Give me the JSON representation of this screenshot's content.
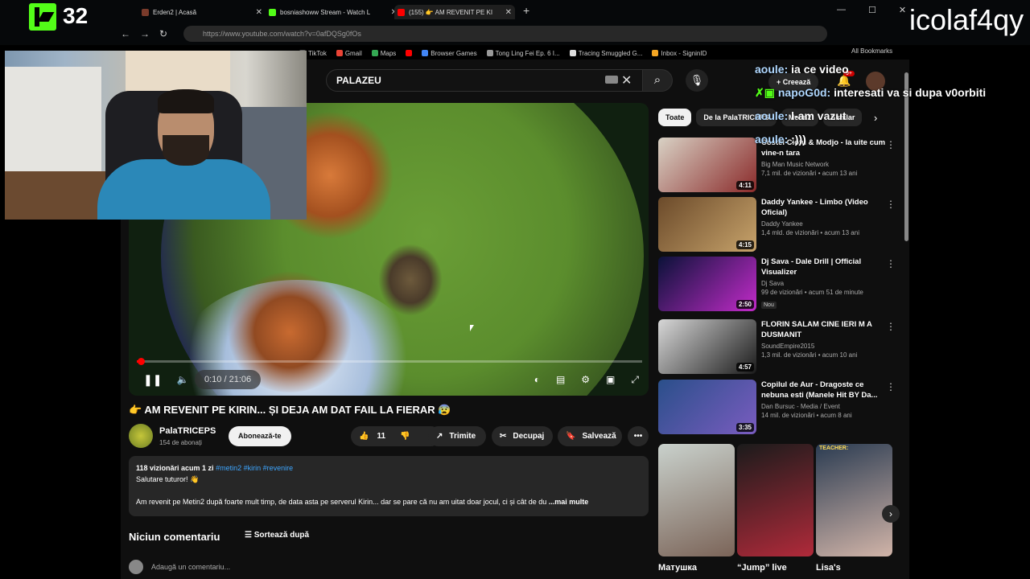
{
  "overlay": {
    "viewer_count": "32",
    "chat_handle": "icolaf4qy",
    "chat": [
      {
        "user": "aoule:",
        "text": "ia ce video"
      },
      {
        "user": "napoG0d:",
        "text": "interesati va si dupa v0orbiti"
      },
      {
        "user": "aoule:",
        "text": "l-am vazut"
      },
      {
        "user": "aoule:",
        "text": ":)))"
      }
    ]
  },
  "browser": {
    "tabs": [
      {
        "label": "Erden2 | Acasă",
        "color": "#7a3b2b"
      },
      {
        "label": "bosniashoww Stream - Watch L",
        "color": "#53fc18"
      },
      {
        "label": "(155) 👉 AM REVENIT PE KI",
        "color": "#ff0000"
      }
    ],
    "url": "https://www.youtube.com/watch?v=0afDQSg0fOs",
    "bookmarks": [
      {
        "label": "TikTok",
        "color": "#111"
      },
      {
        "label": "Gmail",
        "color": "#ea4335"
      },
      {
        "label": "Maps",
        "color": "#34a853"
      },
      {
        "label": "",
        "color": "#ff0000"
      },
      {
        "label": "Browser Games",
        "color": "#4285f4"
      },
      {
        "label": "Tong Ling Fei Ep. 6 I...",
        "color": "#999"
      },
      {
        "label": "Tracing Smuggled G...",
        "color": "#ddd"
      },
      {
        "label": "Inbox - SigninID",
        "color": "#f5a623"
      }
    ],
    "all_bookmarks": "All Bookmarks"
  },
  "youtube": {
    "search_value": "PALAZEU",
    "create_label": "Creează",
    "notif_count": "9+",
    "player": {
      "time": "0:10 / 21:06",
      "progress": 0.008
    },
    "video": {
      "title": "👉 AM REVENIT PE KIRIN... ȘI DEJA AM DAT FAIL LA FIERAR 😰",
      "channel": "PalaTRICEPS",
      "subscribers": "154 de abonați",
      "subscribe_label": "Abonează-te",
      "likes": "11",
      "share_label": "Trimite",
      "cut_label": "Decupaj",
      "save_label": "Salvează",
      "desc_meta": "118 vizionări  acum 1 zi",
      "desc_tags": "#metin2 #kirin #revenire",
      "desc_line1": "Salutare tuturor! 👋",
      "desc_line2": "Am revenit pe Metin2 după foarte mult timp, de data asta pe serverul Kirin... dar se pare că nu am uitat doar jocul, ci și cât de du",
      "desc_more": "...mai multe"
    },
    "comments": {
      "header": "Niciun comentariu",
      "sort_label": "Sortează după",
      "add_placeholder": "Adaugă un comentariu..."
    },
    "chips": [
      "Toate",
      "De la PalaTRICEPS",
      "Metin2",
      "Similar"
    ],
    "recommendations": [
      {
        "title": "Costel Ciofu & Modjo - la uite cum vine-n tara",
        "channel": "Big Man Music Network",
        "meta": "7,1 mil. de vizionări • acum 13 ani",
        "duration": "4:11",
        "colors": [
          "#d9d2c5",
          "#8a2a2a"
        ]
      },
      {
        "title": "Daddy Yankee - Limbo (Video Oficial)",
        "channel": "Daddy Yankee",
        "meta": "1,4 mld. de vizionări • acum 13 ani",
        "duration": "4:15",
        "colors": [
          "#6b4a2a",
          "#c7a36b"
        ]
      },
      {
        "title": "Dj Sava - Dale Drill | Official Visualizer",
        "channel": "Dj Sava",
        "meta": "99 de vizionări • acum 51 de minute",
        "duration": "2:50",
        "badge": "Nou",
        "colors": [
          "#0a1238",
          "#c22bc9"
        ]
      },
      {
        "title": "FLORIN SALAM CINE IERI M A DUSMANIT",
        "channel": "SoundEmpire2015",
        "meta": "1,3 mil. de vizionări • acum 10 ani",
        "duration": "4:57",
        "colors": [
          "#d8d8d8",
          "#1b1b1b"
        ]
      },
      {
        "title": "Copilul de Aur - Dragoste ce nebuna esti (Manele Hit BY Da...",
        "channel": "Dan Bursuc - Media / Event",
        "meta": "14 mil. de vizionări • acum 8 ani",
        "duration": "3:35",
        "colors": [
          "#2a4f8a",
          "#7a5cc0"
        ]
      }
    ],
    "shorts": [
      {
        "title": "Матушка",
        "colors": [
          "#c9d1cc",
          "#7b6458"
        ]
      },
      {
        "title": "“Jump” live",
        "colors": [
          "#1b1b1b",
          "#b02a3a"
        ]
      },
      {
        "title": "Lisa's",
        "colors": [
          "#2b3c52",
          "#d1b4a8"
        ],
        "caption": "TEACHER:"
      }
    ]
  }
}
